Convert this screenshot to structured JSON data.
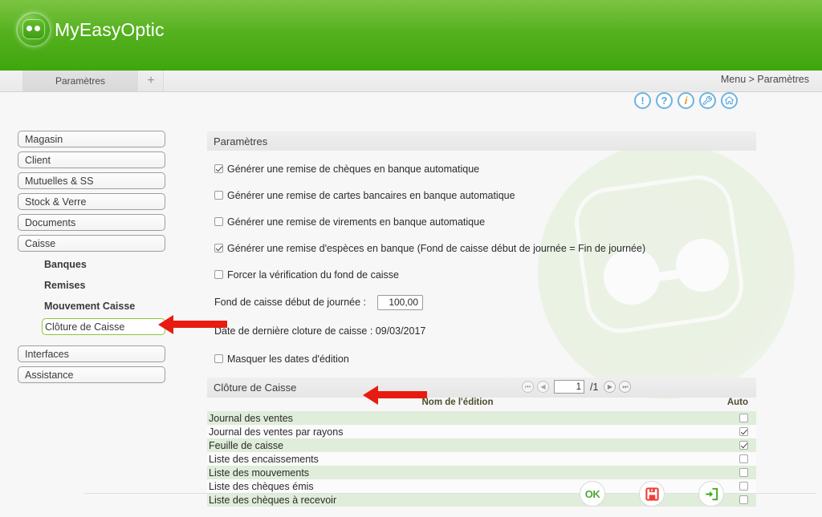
{
  "app": {
    "brand": "MyEasyOptic",
    "logo_icon": "glasses-logo-icon"
  },
  "tabs": {
    "items": [
      {
        "label": "Paramètres"
      }
    ],
    "add_label": "+"
  },
  "breadcrumb": {
    "text": "Menu > Paramètres"
  },
  "toolbar": {
    "icons": [
      {
        "name": "alert-icon",
        "glyph": "!"
      },
      {
        "name": "help-icon",
        "glyph": "?"
      },
      {
        "name": "info-icon",
        "glyph": "i"
      },
      {
        "name": "settings-wrench-icon",
        "glyph": ""
      },
      {
        "name": "home-icon",
        "glyph": ""
      }
    ]
  },
  "sidebar": {
    "items": [
      {
        "label": "Magasin",
        "type": "button"
      },
      {
        "label": "Client",
        "type": "button"
      },
      {
        "label": "Mutuelles & SS",
        "type": "button"
      },
      {
        "label": "Stock & Verre",
        "type": "button"
      },
      {
        "label": "Documents",
        "type": "button"
      },
      {
        "label": "Caisse",
        "type": "button"
      },
      {
        "label": "Banques",
        "type": "sub"
      },
      {
        "label": "Remises",
        "type": "sub"
      },
      {
        "label": "Mouvement Caisse",
        "type": "sub"
      },
      {
        "label": "Clôture de Caisse",
        "type": "sub",
        "selected": true
      },
      {
        "label": "Interfaces",
        "type": "button"
      },
      {
        "label": "Assistance",
        "type": "button"
      }
    ]
  },
  "main": {
    "panel_title": "Paramètres",
    "checkboxes": [
      {
        "label": "Générer une remise de chèques en banque automatique",
        "checked": true
      },
      {
        "label": "Générer une remise de cartes bancaires en banque automatique",
        "checked": false
      },
      {
        "label": "Générer une remise de virements en banque automatique",
        "checked": false
      },
      {
        "label": "Générer une remise d'espèces en banque (Fond de caisse début de journée = Fin de journée)",
        "checked": true
      },
      {
        "label": "Forcer la vérification du fond de caisse",
        "checked": false
      }
    ],
    "fond_caisse": {
      "label": "Fond de caisse début de journée :",
      "value": "100,00"
    },
    "last_closure": {
      "text": "Date de dernière cloture de caisse : 09/03/2017"
    },
    "mask_dates": {
      "label": "Masquer les dates d'édition",
      "checked": false
    }
  },
  "cloture": {
    "title": "Clôture de Caisse",
    "pager": {
      "first": "⏮",
      "prev": "◀",
      "current": "1",
      "total": "/1",
      "next": "▶",
      "last": "⏭"
    },
    "columns": {
      "name": "Nom de l'édition",
      "auto": "Auto"
    },
    "rows": [
      {
        "name": "Journal des ventes",
        "auto": false
      },
      {
        "name": "Journal des ventes par rayons",
        "auto": true
      },
      {
        "name": "Feuille de caisse",
        "auto": true
      },
      {
        "name": "Liste des encaissements",
        "auto": false
      },
      {
        "name": "Liste des mouvements",
        "auto": false
      },
      {
        "name": "Liste des chèques émis",
        "auto": false
      },
      {
        "name": "Liste des chèques à recevoir",
        "auto": false
      }
    ]
  },
  "footer": {
    "buttons": [
      {
        "name": "ok-button",
        "label": "OK"
      },
      {
        "name": "save-button",
        "label": ""
      },
      {
        "name": "exit-button",
        "label": ""
      }
    ]
  },
  "colors": {
    "brand_green": "#55b11f",
    "accent_green": "#8dc63f",
    "row_green": "#dfedda",
    "annotation_red": "#e81b10",
    "icon_blue": "#6db3e0",
    "icon_orange": "#f0922b"
  }
}
